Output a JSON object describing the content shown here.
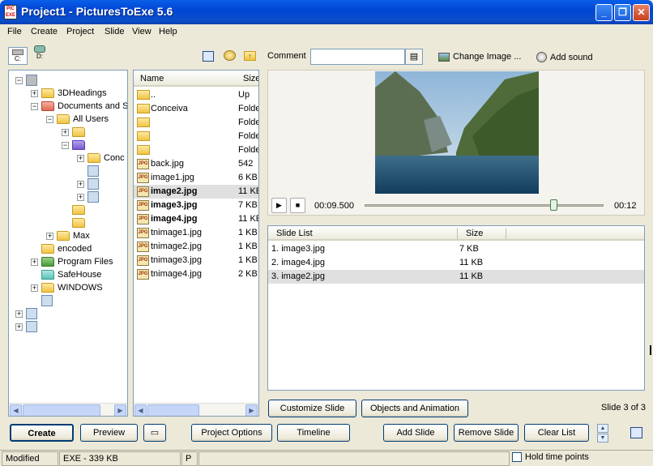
{
  "window": {
    "title": "Project1 - PicturesToExe 5.6",
    "app_icon_text": "PIC EXE"
  },
  "menu": [
    "File",
    "Create",
    "Project",
    "Slide",
    "View",
    "Help"
  ],
  "drives": {
    "c_label": "C:",
    "d_label": "D:"
  },
  "tree": [
    {
      "label": "",
      "indent": 0,
      "exp": "−",
      "icon": "drive"
    },
    {
      "label": "3DHeadings",
      "indent": 1,
      "exp": "+",
      "icon": "folder"
    },
    {
      "label": "Documents and S",
      "indent": 1,
      "exp": "−",
      "icon": "folder red"
    },
    {
      "label": "All Users",
      "indent": 2,
      "exp": "−",
      "icon": "folder"
    },
    {
      "label": "",
      "indent": 3,
      "exp": "+",
      "icon": "folder"
    },
    {
      "label": "",
      "indent": 3,
      "exp": "−",
      "icon": "folder purple"
    },
    {
      "label": "Conc",
      "indent": 4,
      "exp": "+",
      "icon": "folder"
    },
    {
      "label": "",
      "indent": 4,
      "exp": "",
      "icon": "gicon"
    },
    {
      "label": "",
      "indent": 4,
      "exp": "+",
      "icon": "gicon"
    },
    {
      "label": "",
      "indent": 4,
      "exp": "+",
      "icon": "gicon"
    },
    {
      "label": "",
      "indent": 3,
      "exp": "",
      "icon": "folder"
    },
    {
      "label": "",
      "indent": 3,
      "exp": "",
      "icon": "folder"
    },
    {
      "label": "Max",
      "indent": 2,
      "exp": "+",
      "icon": "folder"
    },
    {
      "label": "encoded",
      "indent": 1,
      "exp": "",
      "icon": "folder"
    },
    {
      "label": "Program Files",
      "indent": 1,
      "exp": "+",
      "icon": "folder green"
    },
    {
      "label": "SafeHouse",
      "indent": 1,
      "exp": "",
      "icon": "folder teal"
    },
    {
      "label": "WINDOWS",
      "indent": 1,
      "exp": "+",
      "icon": "folder"
    },
    {
      "label": "",
      "indent": 1,
      "exp": "",
      "icon": "gicon"
    },
    {
      "label": "",
      "indent": 0,
      "exp": "+",
      "icon": "gicon"
    },
    {
      "label": "",
      "indent": 0,
      "exp": "+",
      "icon": "gicon"
    }
  ],
  "files": {
    "col_name": "Name",
    "col_size": "Size",
    "rows": [
      {
        "name": "..",
        "size": "Up",
        "icon": "folder",
        "bold": false,
        "selected": false
      },
      {
        "name": "Conceiva",
        "size": "Folde",
        "icon": "folder",
        "bold": false,
        "selected": false
      },
      {
        "name": "",
        "size": "Folde",
        "icon": "folder",
        "bold": false,
        "selected": false
      },
      {
        "name": "",
        "size": "Folde",
        "icon": "folder",
        "bold": false,
        "selected": false
      },
      {
        "name": "",
        "size": "Folde",
        "icon": "folder",
        "bold": false,
        "selected": false
      },
      {
        "name": "back.jpg",
        "size": "542",
        "icon": "jpg",
        "bold": false,
        "selected": false
      },
      {
        "name": "image1.jpg",
        "size": "6 KB",
        "icon": "jpg",
        "bold": false,
        "selected": false
      },
      {
        "name": "image2.jpg",
        "size": "11 KE",
        "icon": "jpg",
        "bold": true,
        "selected": true
      },
      {
        "name": "image3.jpg",
        "size": "7 KB",
        "icon": "jpg",
        "bold": true,
        "selected": false
      },
      {
        "name": "image4.jpg",
        "size": "11 KE",
        "icon": "jpg",
        "bold": true,
        "selected": false
      },
      {
        "name": "tnimage1.jpg",
        "size": "1 KB",
        "icon": "jpg",
        "bold": false,
        "selected": false
      },
      {
        "name": "tnimage2.jpg",
        "size": "1 KB",
        "icon": "jpg",
        "bold": false,
        "selected": false
      },
      {
        "name": "tnimage3.jpg",
        "size": "1 KB",
        "icon": "jpg",
        "bold": false,
        "selected": false
      },
      {
        "name": "tnimage4.jpg",
        "size": "2 KB",
        "icon": "jpg",
        "bold": false,
        "selected": false
      }
    ]
  },
  "comment": {
    "label": "Comment",
    "value": ""
  },
  "change_image_label": "Change Image ...",
  "add_sound_label": "Add sound",
  "player": {
    "current_time": "00:09.500",
    "total_time": "00:12",
    "position": 0.79
  },
  "slide_list": {
    "col_name": "Slide List",
    "col_size": "Size",
    "rows": [
      {
        "name": "1. image3.jpg",
        "size": "7 KB",
        "selected": false
      },
      {
        "name": "2. image4.jpg",
        "size": "11 KB",
        "selected": false
      },
      {
        "name": "3. image2.jpg",
        "size": "11 KB",
        "selected": true
      }
    ]
  },
  "buttons": {
    "customize_slide": "Customize Slide",
    "objects_animation": "Objects and Animation",
    "create": "Create",
    "preview": "Preview",
    "project_options": "Project Options",
    "timeline": "Timeline",
    "add_slide": "Add Slide",
    "remove_slide": "Remove Slide",
    "clear_list": "Clear List"
  },
  "slide_count": "Slide 3 of 3",
  "status": {
    "state": "Modified",
    "exe_size": "EXE - 339 KB",
    "p": "P",
    "hold_time_points": "Hold time points"
  }
}
